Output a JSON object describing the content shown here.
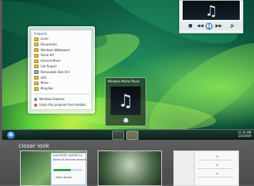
{
  "desktop": {
    "taskbar": {
      "start_label": "⊞",
      "clock_time": "11:31 AM",
      "clock_date": "2/4/2009"
    },
    "jump_list": {
      "header": "Frequent",
      "items": [
        "Lever",
        "Documents",
        "Windows Wallpapers",
        "Steve Art",
        "General Music",
        "Cell Project",
        "Removable Disk (H:)",
        "SAS",
        "Music",
        "Ming Bei"
      ],
      "tasks": [
        "Windows Explorer",
        "Unpin this program from taskbar"
      ]
    },
    "media_thumbnail": {
      "title": "Windows Media Player"
    },
    "player": {
      "controls": [
        "■",
        "◀◀",
        "▶▶",
        "🔊"
      ]
    }
  },
  "closer_look": {
    "title": "closer look",
    "thumb1": {
      "line1": "from MUSIC (\\\\MUSIC) ▸",
      "line2": "About 45 Seconds remaining",
      "more": "More details"
    }
  }
}
